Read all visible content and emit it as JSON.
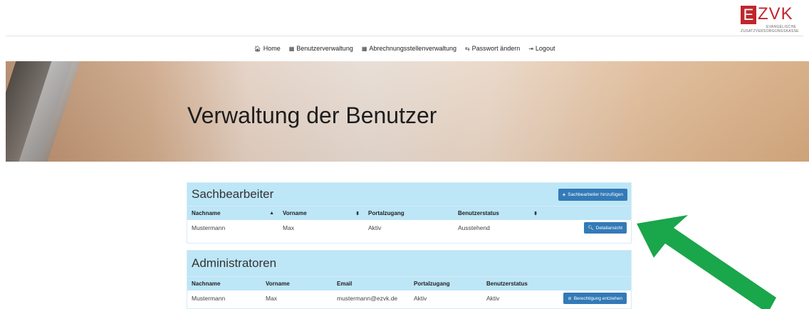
{
  "logo": {
    "e": "E",
    "zvk": "ZVK",
    "line1": "EVANGELISCHE",
    "line2": "ZUSATZVERSORGUNGSKASSE"
  },
  "nav": {
    "items": [
      {
        "icon": "home-icon",
        "glyph": "🏠︎",
        "label": "Home"
      },
      {
        "icon": "table-icon",
        "glyph": "▦",
        "label": "Benutzerverwaltung"
      },
      {
        "icon": "table-icon",
        "glyph": "▦",
        "label": "Abrechnungsstellenverwaltung"
      },
      {
        "icon": "swap-icon",
        "glyph": "⇆",
        "label": "Passwort ändern"
      },
      {
        "icon": "logout-icon",
        "glyph": "⇥",
        "label": "Logout"
      }
    ]
  },
  "hero": {
    "title": "Verwaltung der Benutzer"
  },
  "sachbearbeiter": {
    "title": "Sachbearbeiter",
    "add_button": "Sachbearbeiter hinzufügen",
    "add_icon": "+",
    "columns": [
      "Nachname",
      "Vorname",
      "Portalzugang",
      "Benutzerstatus"
    ],
    "rows": [
      {
        "nachname": "Mustermann",
        "vorname": "Max",
        "portalzugang": "Aktiv",
        "benutzerstatus": "Ausstehend",
        "action": "Detailansicht"
      }
    ]
  },
  "administratoren": {
    "title": "Administratoren",
    "columns": [
      "Nachname",
      "Vorname",
      "Email",
      "Portalzugang",
      "Benutzerstatus"
    ],
    "rows": [
      {
        "nachname": "Mustermann",
        "vorname": "Max",
        "email": "mustermann@ezvk.de",
        "portalzugang": "Aktiv",
        "benutzerstatus": "Aktiv",
        "action": "Berechtigung entziehen"
      }
    ]
  },
  "colors": {
    "brand_red": "#c0262d",
    "panel_header": "#bde6f7",
    "button_blue": "#337ab7",
    "arrow_green": "#1aa64a"
  }
}
